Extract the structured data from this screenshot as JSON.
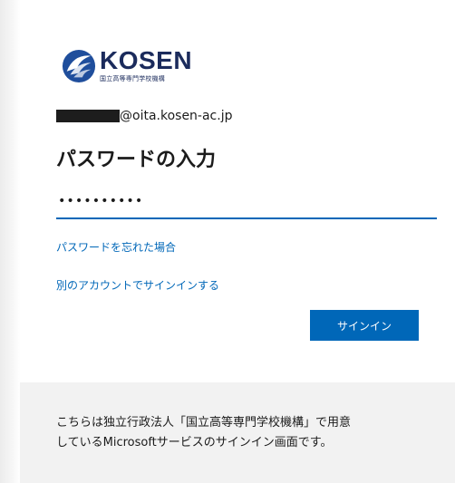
{
  "brand": {
    "name": "KOSEN",
    "subtitle": "国立高等専門学校機構"
  },
  "account": {
    "domain": "@oita.kosen-ac.jp"
  },
  "page": {
    "title": "パスワードの入力"
  },
  "password": {
    "masked_value": "••••••••••"
  },
  "links": {
    "forgot": "パスワードを忘れた場合",
    "other_account": "別のアカウントでサインインする"
  },
  "button": {
    "signin": "サインイン"
  },
  "footer": {
    "notice_line1": "こちらは独立行政法人「国立高等専門学校機構」で用意",
    "notice_line2": "しているMicrosoftサービスのサインイン画面です。"
  },
  "colors": {
    "accent": "#0067b8",
    "brand_navy": "#1b2b5c",
    "footer_bg": "#f2f2f2"
  }
}
